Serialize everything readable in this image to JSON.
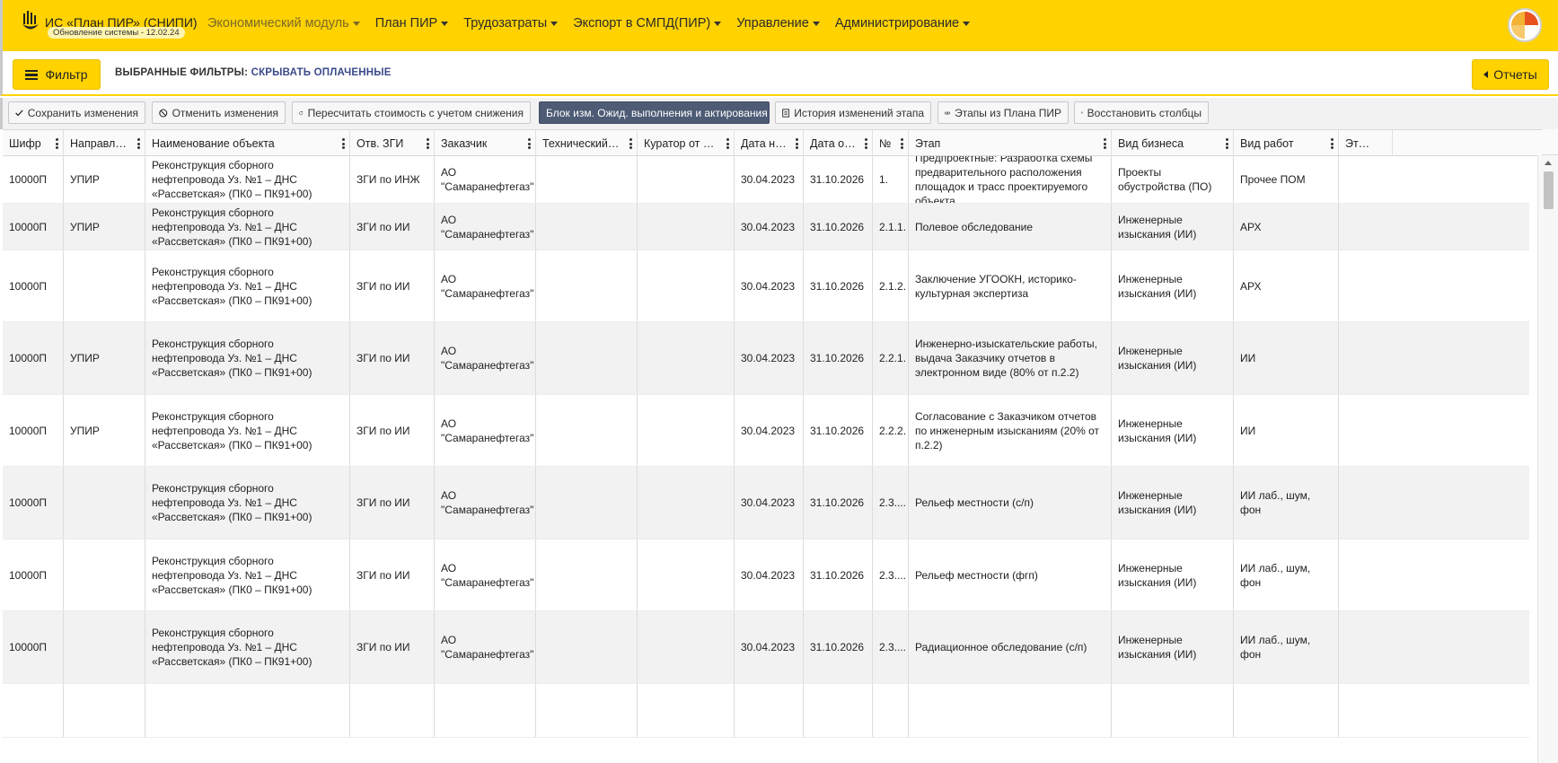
{
  "app": {
    "title": "ИС «План ПИР» (СНИПИ)",
    "update_badge": "Обновление системы - 12.02.24"
  },
  "nav": [
    {
      "label": "Экономический модуль",
      "active": true
    },
    {
      "label": "План ПИР",
      "active": false
    },
    {
      "label": "Трудозатраты",
      "active": false
    },
    {
      "label": "Экспорт в СМПД(ПИР)",
      "active": false
    },
    {
      "label": "Управление",
      "active": false
    },
    {
      "label": "Администрирование",
      "active": false
    }
  ],
  "filterbar": {
    "filter_button": "Фильтр",
    "selected_label": "ВЫБРАННЫЕ ФИЛЬТРЫ:",
    "selected_value": "СКРЫВАТЬ ОПЛАЧЕННЫЕ",
    "reports_button": "Отчеты"
  },
  "toolbar": {
    "save": "Сохранить изменения",
    "cancel": "Отменить изменения",
    "recalc": "Пересчитать стоимость с учетом снижения",
    "block": "Блок изм. Ожид. выполнения и актирования",
    "history": "История изменений этапа",
    "stages": "Этапы из Плана ПИР",
    "restore": "Восстановить столбцы"
  },
  "columns": [
    "Шифр",
    "Направлен…",
    "Наименование объекта",
    "Отв. ЗГИ",
    "Заказчик",
    "Технический За…",
    "Куратор от Зак…",
    "Дата нач…",
    "Дата око…",
    "№…",
    "Этап",
    "Вид бизнеса",
    "Вид работ",
    "Этап Мон"
  ],
  "rows": [
    {
      "code": "10000П",
      "direction": "УПИР",
      "object": "Реконструкция сборного нефтепровода Уз. №1 – ДНС «Рассветская» (ПК0 – ПК91+00)",
      "zgi": "ЗГИ по ИНЖ",
      "customer": "АО \"Самаранефтегаз\"",
      "tech": "",
      "curator": "",
      "start": "30.04.2023",
      "end": "31.10.2026",
      "num": "1.",
      "stage": "Предпроектные: Разработка схемы предварительного расположения площадок и трасс проектируемого объекта",
      "business": "Проекты обустройства (ПО)",
      "work": "Прочее ПОМ"
    },
    {
      "code": "10000П",
      "direction": "УПИР",
      "object": "Реконструкция сборного нефтепровода Уз. №1 – ДНС «Рассветская» (ПК0 – ПК91+00)",
      "zgi": "ЗГИ по ИИ",
      "customer": "АО \"Самаранефтегаз\"",
      "tech": "",
      "curator": "",
      "start": "30.04.2023",
      "end": "31.10.2026",
      "num": "2.1.1.",
      "stage": "Полевое обследование",
      "business": "Инженерные изыскания (ИИ)",
      "work": "АРХ"
    },
    {
      "code": "10000П",
      "direction": "",
      "object": "Реконструкция сборного нефтепровода Уз. №1 – ДНС «Рассветская» (ПК0 – ПК91+00)",
      "zgi": "ЗГИ по ИИ",
      "customer": "АО \"Самаранефтегаз\"",
      "tech": "",
      "curator": "",
      "start": "30.04.2023",
      "end": "31.10.2026",
      "num": "2.1.2.",
      "stage": "Заключение УГООКН, историко-культурная экспертиза",
      "business": "Инженерные изыскания (ИИ)",
      "work": "АРХ"
    },
    {
      "code": "10000П",
      "direction": "УПИР",
      "object": "Реконструкция сборного нефтепровода Уз. №1 – ДНС «Рассветская» (ПК0 – ПК91+00)",
      "zgi": "ЗГИ по ИИ",
      "customer": "АО \"Самаранефтегаз\"",
      "tech": "",
      "curator": "",
      "start": "30.04.2023",
      "end": "31.10.2026",
      "num": "2.2.1.",
      "stage": "Инженерно-изыскательские работы, выдача Заказчику отчетов в электронном виде (80% от п.2.2)",
      "business": "Инженерные изыскания (ИИ)",
      "work": "ИИ"
    },
    {
      "code": "10000П",
      "direction": "УПИР",
      "object": "Реконструкция сборного нефтепровода Уз. №1 – ДНС «Рассветская» (ПК0 – ПК91+00)",
      "zgi": "ЗГИ по ИИ",
      "customer": "АО \"Самаранефтегаз\"",
      "tech": "",
      "curator": "",
      "start": "30.04.2023",
      "end": "31.10.2026",
      "num": "2.2.2.",
      "stage": "Согласование с Заказчиком отчетов по инженерным изысканиям (20% от п.2.2)",
      "business": "Инженерные изыскания (ИИ)",
      "work": "ИИ"
    },
    {
      "code": "10000П",
      "direction": "",
      "object": "Реконструкция сборного нефтепровода Уз. №1 – ДНС «Рассветская» (ПК0 – ПК91+00)",
      "zgi": "ЗГИ по ИИ",
      "customer": "АО \"Самаранефтегаз\"",
      "tech": "",
      "curator": "",
      "start": "30.04.2023",
      "end": "31.10.2026",
      "num": "2.3....",
      "stage": "Рельеф местности (с/п)",
      "business": "Инженерные изыскания (ИИ)",
      "work": "ИИ лаб., шум, фон"
    },
    {
      "code": "10000П",
      "direction": "",
      "object": "Реконструкция сборного нефтепровода Уз. №1 – ДНС «Рассветская» (ПК0 – ПК91+00)",
      "zgi": "ЗГИ по ИИ",
      "customer": "АО \"Самаранефтегаз\"",
      "tech": "",
      "curator": "",
      "start": "30.04.2023",
      "end": "31.10.2026",
      "num": "2.3....",
      "stage": "Рельеф местности (фгп)",
      "business": "Инженерные изыскания (ИИ)",
      "work": "ИИ лаб., шум, фон"
    },
    {
      "code": "10000П",
      "direction": "",
      "object": "Реконструкция сборного нефтепровода Уз. №1 – ДНС «Рассветская» (ПК0 – ПК91+00)",
      "zgi": "ЗГИ по ИИ",
      "customer": "АО \"Самаранефтегаз\"",
      "tech": "",
      "curator": "",
      "start": "30.04.2023",
      "end": "31.10.2026",
      "num": "2.3....",
      "stage": "Радиационное обследование (с/п)",
      "business": "Инженерные изыскания (ИИ)",
      "work": "ИИ лаб., шум, фон"
    },
    {
      "code": "",
      "direction": "",
      "object": "",
      "zgi": "",
      "customer": "",
      "tech": "",
      "curator": "",
      "start": "",
      "end": "",
      "num": "",
      "stage": "",
      "business": "",
      "work": ""
    }
  ],
  "colors": {
    "brand_yellow": "#ffd200",
    "primary_button": "#4d5b75",
    "active_nav": "#7a6a2a",
    "filter_value": "#3a4a8a"
  },
  "icons": {
    "logo": "rosneft-logo",
    "user": "pie-chart-avatar",
    "save": "check-icon",
    "cancel": "cancel-icon",
    "recalc": "refresh-icon",
    "history": "document-icon",
    "stages": "link-icon",
    "restore": "table-icon"
  }
}
